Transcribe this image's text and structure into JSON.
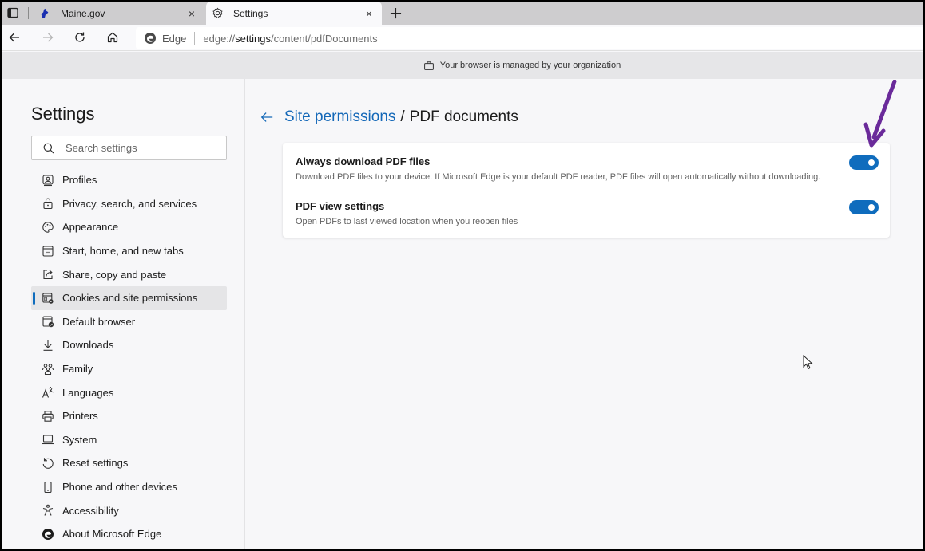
{
  "browser": {
    "tabs": [
      {
        "title": "Maine.gov",
        "icon": "maine-state-icon",
        "active": false,
        "close_label": "×"
      },
      {
        "title": "Settings",
        "icon": "gear-icon",
        "active": true,
        "close_label": "×"
      }
    ],
    "new_tab_label": "+",
    "address_bar": {
      "site_label": "Edge",
      "url_prefix": "edge://",
      "url_host": "settings",
      "url_path": "/content/pdfDocuments"
    },
    "managed_banner": "Your browser is managed by your organization"
  },
  "sidebar": {
    "title": "Settings",
    "search_placeholder": "Search settings",
    "items": [
      {
        "label": "Profiles",
        "icon": "profile-icon",
        "selected": false
      },
      {
        "label": "Privacy, search, and services",
        "icon": "lock-icon",
        "selected": false
      },
      {
        "label": "Appearance",
        "icon": "palette-icon",
        "selected": false
      },
      {
        "label": "Start, home, and new tabs",
        "icon": "start-page-icon",
        "selected": false
      },
      {
        "label": "Share, copy and paste",
        "icon": "share-icon",
        "selected": false
      },
      {
        "label": "Cookies and site permissions",
        "icon": "cookies-permissions-icon",
        "selected": true
      },
      {
        "label": "Default browser",
        "icon": "default-browser-icon",
        "selected": false
      },
      {
        "label": "Downloads",
        "icon": "download-icon",
        "selected": false
      },
      {
        "label": "Family",
        "icon": "family-icon",
        "selected": false
      },
      {
        "label": "Languages",
        "icon": "languages-icon",
        "selected": false
      },
      {
        "label": "Printers",
        "icon": "printer-icon",
        "selected": false
      },
      {
        "label": "System",
        "icon": "laptop-icon",
        "selected": false
      },
      {
        "label": "Reset settings",
        "icon": "reset-icon",
        "selected": false
      },
      {
        "label": "Phone and other devices",
        "icon": "phone-icon",
        "selected": false
      },
      {
        "label": "Accessibility",
        "icon": "accessibility-icon",
        "selected": false
      },
      {
        "label": "About Microsoft Edge",
        "icon": "edge-logo-icon",
        "selected": false
      }
    ]
  },
  "main": {
    "breadcrumb_parent": "Site permissions",
    "breadcrumb_separator": "/",
    "breadcrumb_current": "PDF documents",
    "settings": [
      {
        "title": "Always download PDF files",
        "description": "Download PDF files to your device. If Microsoft Edge is your default PDF reader, PDF files will open automatically without downloading.",
        "enabled": true
      },
      {
        "title": "PDF view settings",
        "description": "Open PDFs to last viewed location when you reopen files",
        "enabled": true
      }
    ]
  },
  "colors": {
    "accent": "#0f6cbd",
    "link": "#1468b8",
    "annotation_arrow": "#6a2a9a"
  }
}
